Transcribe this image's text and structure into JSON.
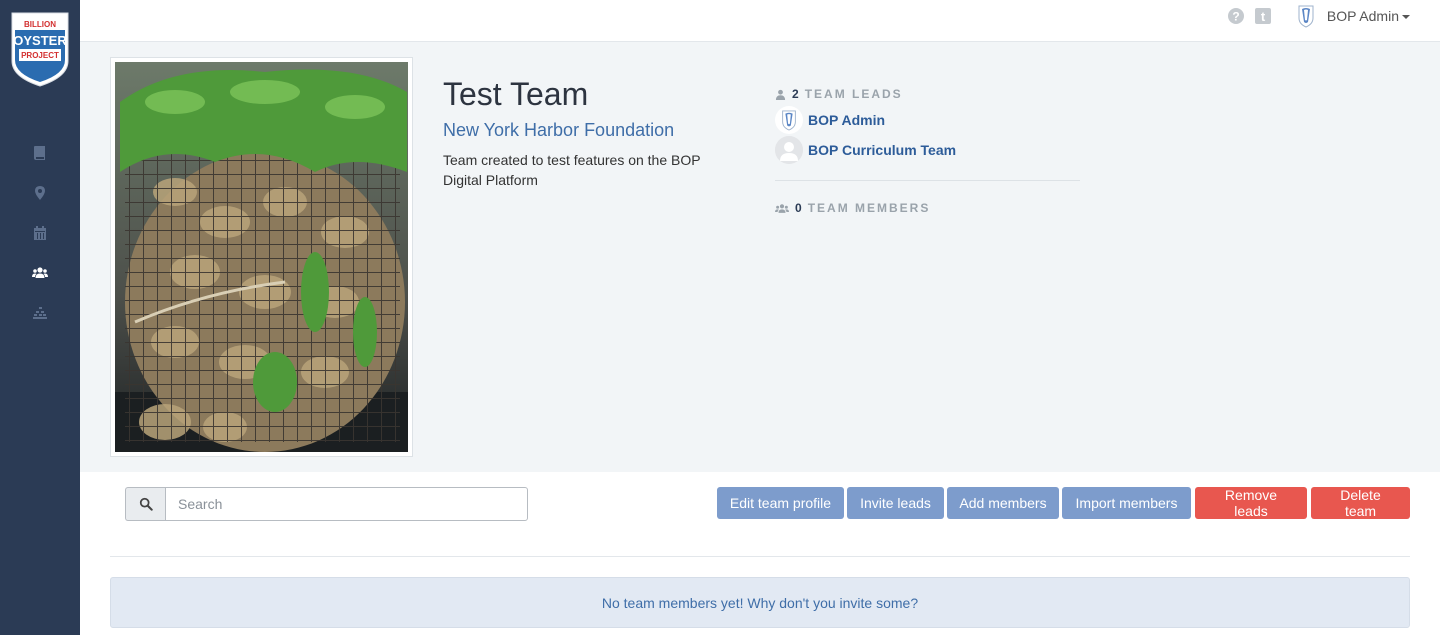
{
  "logo": {
    "line1": "BILLION",
    "line2": "OYSTER",
    "line3": "PROJECT"
  },
  "sidebar": {
    "items": [
      {
        "icon": "book-icon",
        "label": "Resources"
      },
      {
        "icon": "map-marker-icon",
        "label": "Sites"
      },
      {
        "icon": "calendar-icon",
        "label": "Events"
      },
      {
        "icon": "users-icon",
        "label": "Teams",
        "active": true
      },
      {
        "icon": "chart-icon",
        "label": "Data"
      }
    ]
  },
  "topbar": {
    "help_icon": "question-circle-icon",
    "tumblr_icon": "tumblr-icon",
    "user_name": "BOP Admin"
  },
  "team": {
    "name": "Test Team",
    "organization": "New York Harbor Foundation",
    "description": "Team created to test features on the BOP Digital Platform",
    "leads_count": "2",
    "leads_label": "TEAM LEADS",
    "leads": [
      {
        "name": "BOP Admin",
        "avatar": "oyster-logo"
      },
      {
        "name": "BOP Curriculum Team",
        "avatar": "default-avatar"
      }
    ],
    "members_count": "0",
    "members_label": "TEAM MEMBERS"
  },
  "search": {
    "placeholder": "Search",
    "value": ""
  },
  "actions": {
    "edit": "Edit team profile",
    "invite": "Invite leads",
    "add": "Add members",
    "import": "Import members",
    "remove": "Remove leads",
    "delete": "Delete team"
  },
  "empty_message": "No team members yet! Why don't you invite some?",
  "colors": {
    "sidebar": "#2b3b55",
    "primary_button": "#7d9ccc",
    "danger_button": "#e8574f",
    "link": "#3f6ea8"
  }
}
